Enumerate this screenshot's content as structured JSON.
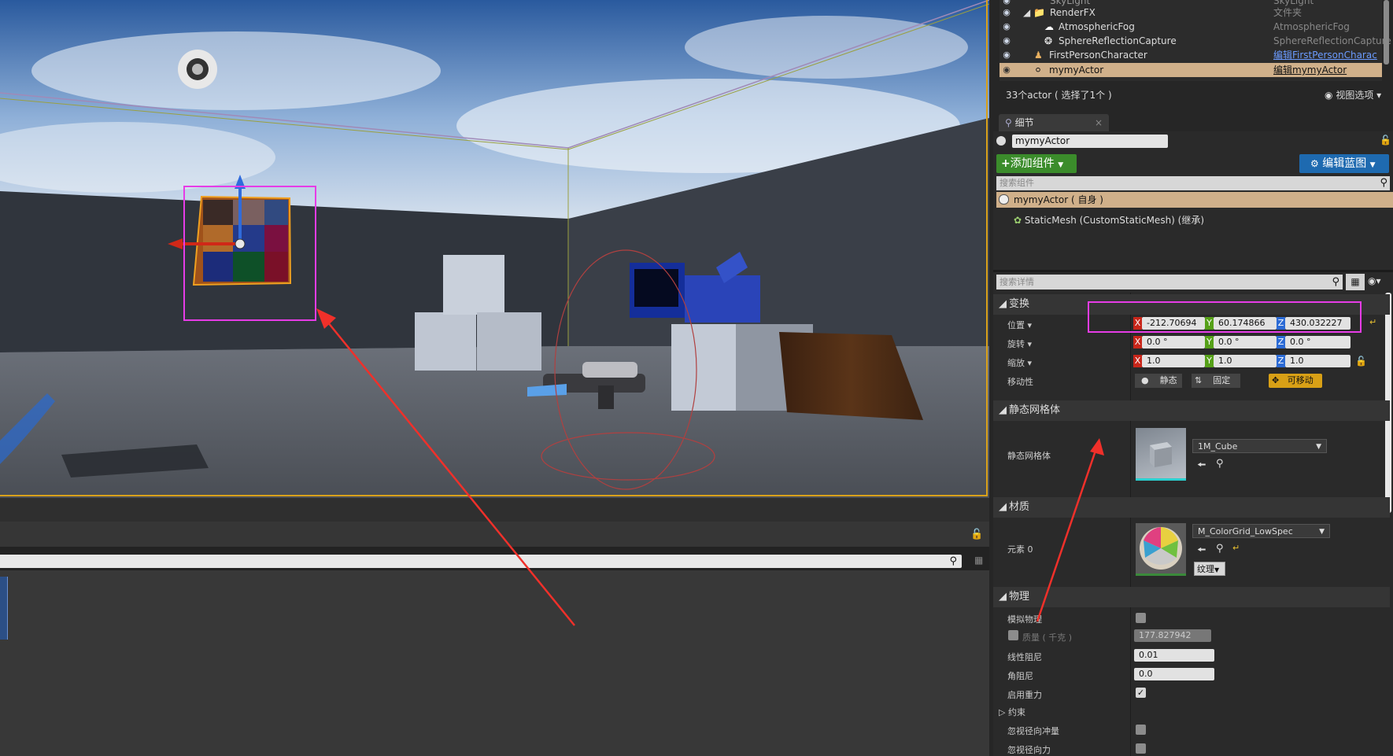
{
  "outliner": {
    "rows": [
      {
        "name": "SkyLight",
        "type": "SkyLight"
      },
      {
        "name": "RenderFX",
        "type": "文件夹"
      },
      {
        "name": "AtmosphericFog",
        "type": "AtmosphericFog"
      },
      {
        "name": "SphereReflectionCapture",
        "type": "SphereReflectionCapture"
      },
      {
        "name": "FirstPersonCharacter",
        "type": "编辑FirstPersonCharac"
      },
      {
        "name": "mymyActor",
        "type": "编辑mymyActor"
      }
    ],
    "actor_count": "33个actor ( 选择了1个 )",
    "view_options": "视图选项"
  },
  "details": {
    "tab_label": "细节",
    "name_value": "mymyActor",
    "add_component": "添加组件",
    "edit_blueprint": "编辑蓝图",
    "search_components_placeholder": "搜索组件",
    "component_self": "mymyActor ( 自身 )",
    "component_mesh": "StaticMesh (CustomStaticMesh) (继承)",
    "search_details_placeholder": "搜索详情"
  },
  "transform": {
    "category": "变换",
    "location_label": "位置",
    "rotation_label": "旋转",
    "scale_label": "缩放",
    "mobility_label": "移动性",
    "location": {
      "x": "-212.70694",
      "y": "60.174866",
      "z": "430.032227"
    },
    "rotation": {
      "x": "0.0 °",
      "y": "0.0 °",
      "z": "0.0 °"
    },
    "scale": {
      "x": "1.0",
      "y": "1.0",
      "z": "1.0"
    },
    "mobility": {
      "static": "静态",
      "stationary": "固定",
      "movable": "可移动"
    },
    "axis": {
      "x": "X",
      "y": "Y",
      "z": "Z"
    }
  },
  "static_mesh": {
    "category": "静态网格体",
    "label": "静态网格体",
    "value": "1M_Cube"
  },
  "materials": {
    "category": "材质",
    "element_label": "元素 0",
    "value": "M_ColorGrid_LowSpec",
    "texture_btn": "纹理"
  },
  "physics": {
    "category": "物理",
    "simulate_label": "模拟物理",
    "mass_label": "质量 ( 千克 )",
    "mass_value": "177.827942",
    "linear_damping_label": "线性阻尼",
    "linear_damping_value": "0.01",
    "angular_damping_label": "角阻尼",
    "angular_damping_value": "0.0",
    "gravity_label": "启用重力",
    "constraints_label": "约束",
    "ignore_radial_impulse": "忽视径向冲量",
    "ignore_radial_force": "忽视径向力"
  },
  "colors": {
    "highlight": "#e63ce6",
    "annotation_arrow": "#f0302a",
    "selected_row": "#d0b08a",
    "add_button": "#3b8c2b",
    "blueprint_button": "#1e6ab0"
  }
}
